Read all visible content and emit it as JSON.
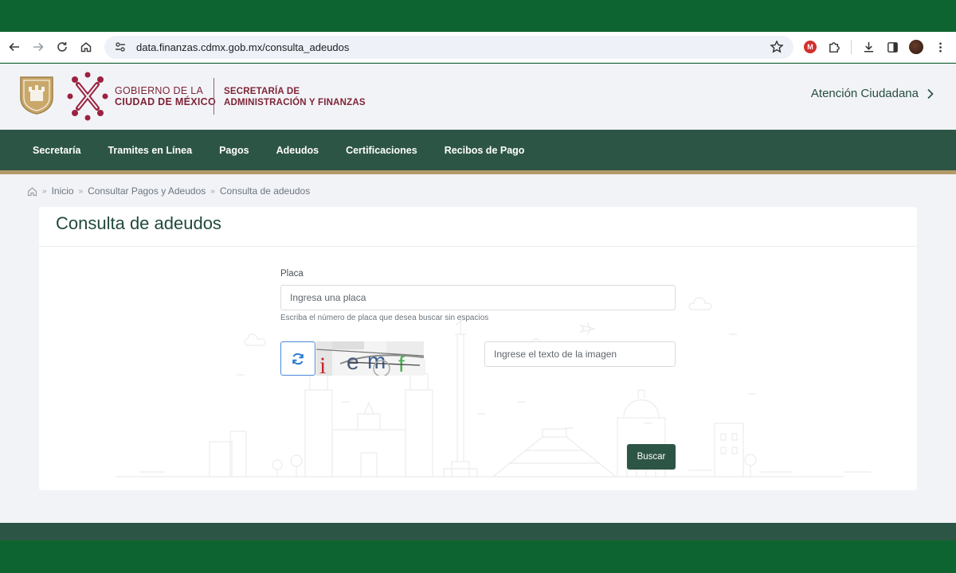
{
  "browser": {
    "url": "data.finanzas.cdmx.gob.mx/consulta_adeudos"
  },
  "header": {
    "gov_line1": "GOBIERNO DE LA",
    "gov_line2": "CIUDAD DE MÉXICO",
    "sec_line1": "SECRETARÍA DE",
    "sec_line2": "ADMINISTRACIÓN Y FINANZAS",
    "atencion": "Atención Ciudadana"
  },
  "nav": {
    "items": [
      {
        "label": "Secretaría"
      },
      {
        "label": "Tramites en Línea"
      },
      {
        "label": "Pagos"
      },
      {
        "label": "Adeudos"
      },
      {
        "label": "Certificaciones"
      },
      {
        "label": "Recibos de Pago"
      }
    ]
  },
  "breadcrumb": {
    "items": [
      "Inicio",
      "Consultar Pagos y Adeudos",
      "Consulta de adeudos"
    ]
  },
  "page": {
    "title": "Consulta de adeudos"
  },
  "form": {
    "placa_label": "Placa",
    "placa_placeholder": "Ingresa una placa",
    "placa_help": "Escriba el número de placa que desea buscar sin espacios",
    "captcha_text": "i emf",
    "captcha_placeholder": "Ingrese el texto de la imagen",
    "submit_label": "Buscar"
  },
  "colors": {
    "brand_green": "#2d5545",
    "outer_green": "#0e6430",
    "brand_maroon": "#7e2436",
    "gold": "#b39a6a"
  },
  "icons": [
    "back-icon",
    "forward-icon",
    "reload-icon",
    "home-icon",
    "site-settings-icon",
    "bookmark-star-icon",
    "extension-m-icon",
    "puzzle-icon",
    "download-icon",
    "sidepanel-icon",
    "chevron-right-icon",
    "refresh-icon"
  ]
}
